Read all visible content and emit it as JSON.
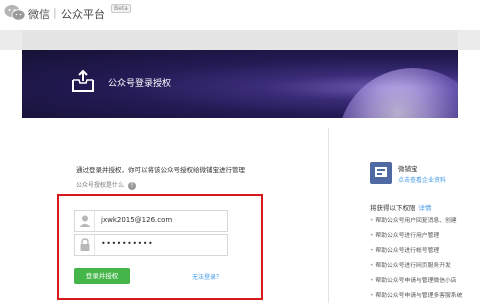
{
  "header": {
    "brand": "微信",
    "separator": "|",
    "platform": "公众平台",
    "beta": "Beta"
  },
  "banner": {
    "title": "公众号登录授权"
  },
  "login": {
    "intro": "通过登录并授权，你可以将该公众号授权给微铺宝进行管理",
    "what_is_auth": "公众号授权是什么",
    "help_symbol": "?",
    "username": "jxwk2015@126.com",
    "password_masked": "••••••••••",
    "submit_label": "登录并授权",
    "cant_login": "无法登录？"
  },
  "sidebar": {
    "app_name": "微铺宝",
    "app_link": "点击查看企业资料",
    "permissions_title": "将获得以下权限",
    "permissions_detail": "详情",
    "permissions": [
      "帮助公众号用户回复消息、创建",
      "帮助公众号进行用户管理",
      "帮助公众号进行帐号管理",
      "帮助公众号进行网页服务开发",
      "帮助公众号申请与管理微信小店",
      "帮助公众号申请与管理多客服系统"
    ]
  },
  "colors": {
    "accent_green": "#44b549",
    "link_blue": "#459ae9",
    "highlight_red": "#d8191c",
    "banner_dark": "#221a52"
  }
}
